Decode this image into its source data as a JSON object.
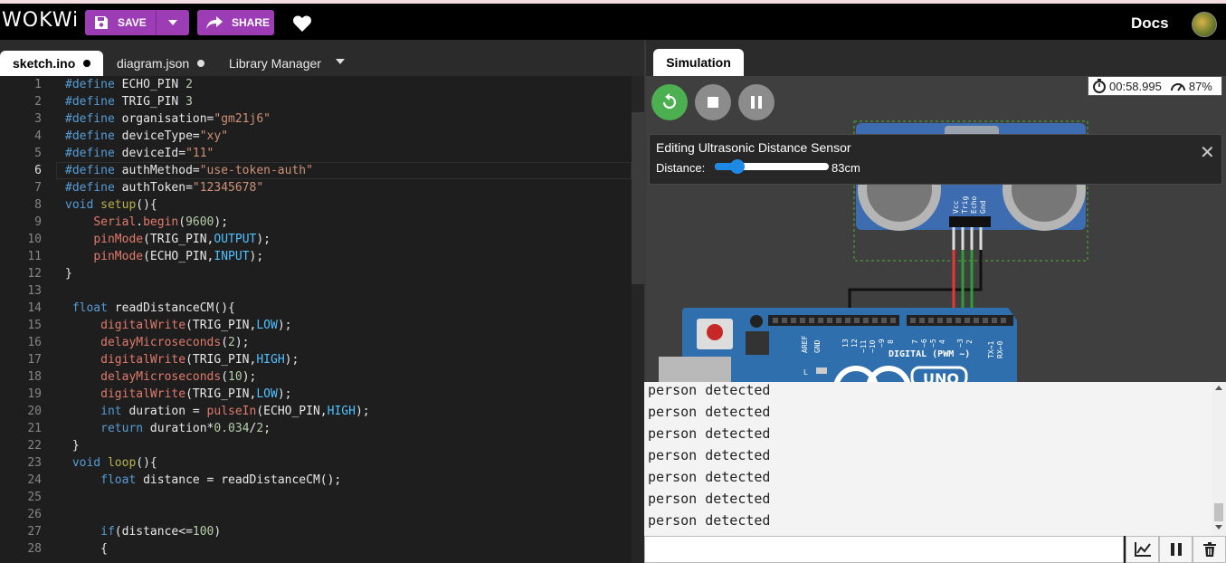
{
  "app": {
    "logo": "WOKWi",
    "docs_label": "Docs"
  },
  "toolbar": {
    "save_label": "SAVE",
    "share_label": "SHARE"
  },
  "editor_tabs": [
    {
      "label": "sketch.ino",
      "active": true,
      "modified": true
    },
    {
      "label": "diagram.json",
      "active": false,
      "modified": true
    },
    {
      "label": "Library Manager",
      "active": false,
      "modified": false
    }
  ],
  "code": {
    "current_line": 6,
    "lines": [
      "#define ECHO_PIN 2",
      "#define TRIG_PIN 3",
      "#define organisation=\"gm21j6\"",
      "#define deviceType=\"xy\"",
      "#define deviceId=\"11\"",
      "#define authMethod=\"use-token-auth\"",
      "#define authToken=\"12345678\"",
      "void setup(){",
      "    Serial.begin(9600);",
      "    pinMode(TRIG_PIN,OUTPUT);",
      "    pinMode(ECHO_PIN,INPUT);",
      "}",
      "",
      " float readDistanceCM(){",
      "     digitalWrite(TRIG_PIN,LOW);",
      "     delayMicroseconds(2);",
      "     digitalWrite(TRIG_PIN,HIGH);",
      "     delayMicroseconds(10);",
      "     digitalWrite(TRIG_PIN,LOW);",
      "     int duration = pulseIn(ECHO_PIN,HIGH);",
      "     return duration*0.034/2;",
      " }",
      " void loop(){",
      "     float distance = readDistanceCM();",
      "",
      "",
      "     if(distance<=100)",
      "     {"
    ]
  },
  "simulation": {
    "tab_label": "Simulation",
    "timer": "00:58.995",
    "speed": "87%",
    "edit_panel": {
      "title": "Editing Ultrasonic Distance Sensor",
      "label": "Distance:",
      "value": "83cm",
      "slider_fraction": 0.2
    },
    "sensor_pins": [
      "Vcc",
      "Trig",
      "Echo",
      "Gnd"
    ],
    "board_labels": {
      "aref": "AREF",
      "gnd": "GND",
      "pins": [
        "13",
        "12",
        "~11",
        "~10",
        "~9",
        "8",
        "7",
        "~6",
        "~5",
        "4",
        "~3",
        "2",
        "TX→1",
        "RX←0"
      ],
      "digital": "DIGITAL (PWM ~)",
      "l": "L",
      "uno": "UNO"
    }
  },
  "serial": {
    "lines": [
      "person detected",
      "person detected",
      "person detected",
      "person detected",
      "person detected",
      "person detected",
      "person detected"
    ],
    "input_value": ""
  },
  "colors": {
    "accent": "#9c3db6",
    "header": "#000000",
    "canvas": "#3f3f3f",
    "play": "#4caf50",
    "wire_red": "#e53935",
    "wire_green": "#2e9e3a"
  }
}
